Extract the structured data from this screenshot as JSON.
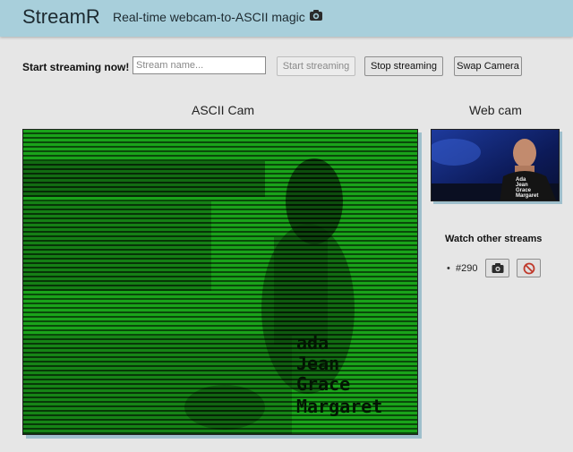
{
  "header": {
    "app_title": "StreamR",
    "tagline": "Real-time webcam-to-ASCII magic",
    "tagline_icon": "camera-icon"
  },
  "toolbar": {
    "label": "Start streaming now!",
    "stream_name_value": "",
    "stream_name_placeholder": "Stream name...",
    "start_label": "Start streaming",
    "start_disabled": true,
    "stop_label": "Stop streaming",
    "swap_label": "Swap Camera"
  },
  "panels": {
    "ascii_label": "ASCII Cam",
    "webcam_label": "Web cam"
  },
  "ascii_overlay_text": [
    "ada",
    "Jean",
    "Grace",
    "Margaret"
  ],
  "webcam_shirt_text": [
    "Ada",
    "Jean",
    "Grace",
    "Margaret"
  ],
  "other_streams": {
    "title": "Watch other streams",
    "items": [
      {
        "id": "#290",
        "watch_icon": "camera-icon",
        "block_icon": "prohibited-icon"
      }
    ]
  },
  "colors": {
    "header_bg": "#a8cfdb",
    "ascii_green": "#1aa31a",
    "ascii_dark": "#0a4a0a",
    "page_bg": "#e6e6e6"
  }
}
